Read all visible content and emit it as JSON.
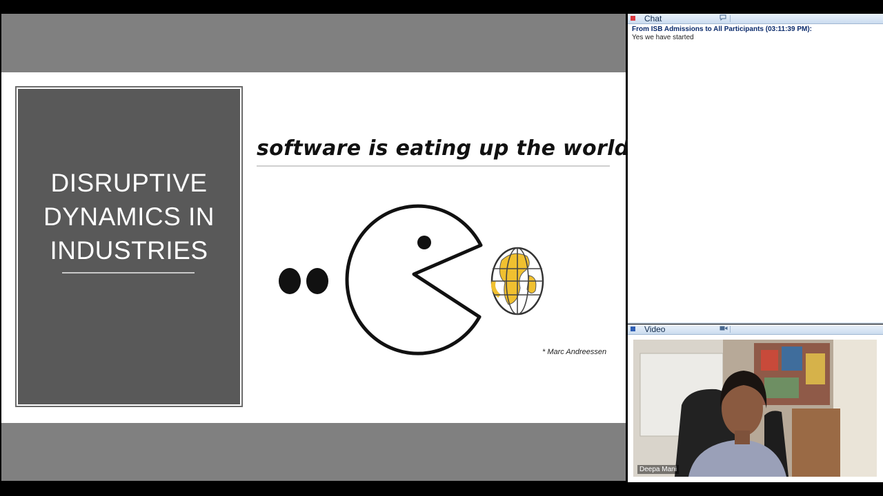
{
  "slide": {
    "title_lines": [
      "DISRUPTIVE",
      "DYNAMICS IN",
      "INDUSTRIES"
    ],
    "headline": "software is eating up the world*",
    "attribution": "* Marc Andreessen"
  },
  "chat": {
    "header_label": "Chat",
    "header_icon": "chat-bubble-icon",
    "messages": [
      {
        "from": "From ISB Admissions to All Participants (03:11:39 PM):",
        "text": "Yes we have started"
      }
    ]
  },
  "video": {
    "header_label": "Video",
    "header_icon": "camera-icon",
    "participant_name": "Deepa Mani"
  },
  "colors": {
    "band_gray": "#808080",
    "title_panel": "#595959",
    "chat_header_dot": "#d9383f",
    "video_header_dot": "#2f5fb5",
    "globe_land": "#f0c030"
  }
}
